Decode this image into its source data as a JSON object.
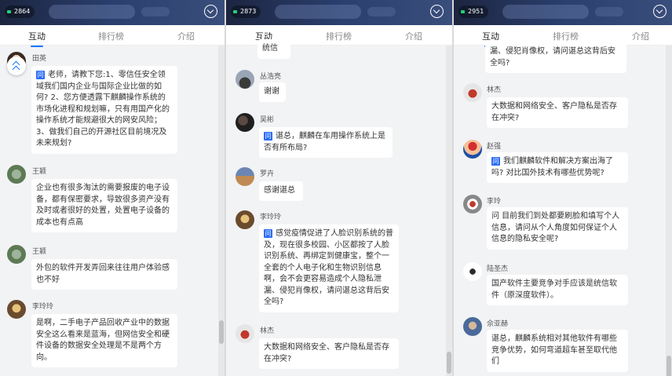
{
  "panels": [
    {
      "viewer_count": "2864",
      "tabs": [
        "互动",
        "排行榜",
        "介绍"
      ],
      "messages": [
        {
          "name": "田英",
          "question": true,
          "text": "老师，请教下您:1、零信任安全领域我们国内企业与国际企业比做的如何? 2、您方便透露下麒麟操作系统的市场化进程和规划嘛，只有用国产化的操作系统才能规避很大的网安风险；3、做我们自己的开源社区目前境况及未来规划?"
        },
        {
          "name": "王颖",
          "question": false,
          "text": "企业也有很多淘汰的需要报废的电子设备，都有保密要求，导致很多资产没有及时或者很好的处置，处置电子设备的成本也有点高"
        },
        {
          "name": "王颖",
          "question": false,
          "text": "外包的软件开发弄回来往往用户体验感也不好"
        },
        {
          "name": "李玲玲",
          "question": false,
          "text": "是啊，二手电子产品回收产业中的数据安全这么看来是蓝海，但网信安全和硬件设备的数据安全处理是不是两个方向。"
        }
      ]
    },
    {
      "viewer_count": "2873",
      "tabs": [
        "互动",
        "排行榜",
        "介绍"
      ],
      "messages": [
        {
          "name": "",
          "question": false,
          "text": "统信"
        },
        {
          "name": "丛浩亮",
          "question": false,
          "text": "谢谢"
        },
        {
          "name": "吴彬",
          "question": true,
          "text": "谌总，麒麟在车用操作系统上是否有所布局?"
        },
        {
          "name": "罗卉",
          "question": false,
          "text": "感谢谌总"
        },
        {
          "name": "李玲玲",
          "question": true,
          "text": "感觉疫情促进了人脸识别系统的普及，现在很多校园、小区都按了人脸识别系统、再绑定到健康宝，整个一全套的个人电子化和生物识别信息啊，会不会更容易造成个人隐私泄漏、侵犯肖像权，请问谌总这背后安全吗?"
        },
        {
          "name": "林杰",
          "question": false,
          "text": "大数据和网络安全、客户隐私是否存在冲突?"
        }
      ]
    },
    {
      "viewer_count": "2951",
      "tabs": [
        "互动",
        "排行榜",
        "介绍"
      ],
      "messages": [
        {
          "name": "",
          "question": false,
          "text": "漏、侵犯肖像权，请问谌总这背后安全吗?"
        },
        {
          "name": "林杰",
          "question": false,
          "text": "大数据和网络安全、客户隐私是否存在冲突?"
        },
        {
          "name": "赵强",
          "question": true,
          "text": "我们麒麟软件和解决方案出海了吗? 对比国外技术有哪些优势呢?"
        },
        {
          "name": "李玲",
          "question": false,
          "text": "问 目前我们到处都要刷脸和填写个人信息，请问从个人角度如何保证个人信息的隐私安全呢?"
        },
        {
          "name": "陆圣杰",
          "question": false,
          "text": "国产软件主要竞争对手应该是统信软件（原深度软件）。"
        },
        {
          "name": "佘亚赫",
          "question": false,
          "text": "谌总，麒麟系统相对其他软件有哪些竞争优势，如何弯道超车甚至取代他们"
        }
      ]
    }
  ],
  "colors": {
    "accent": "#1677ff",
    "question_tag": "#2b6cf6",
    "live_dot": "#1fd17a"
  }
}
